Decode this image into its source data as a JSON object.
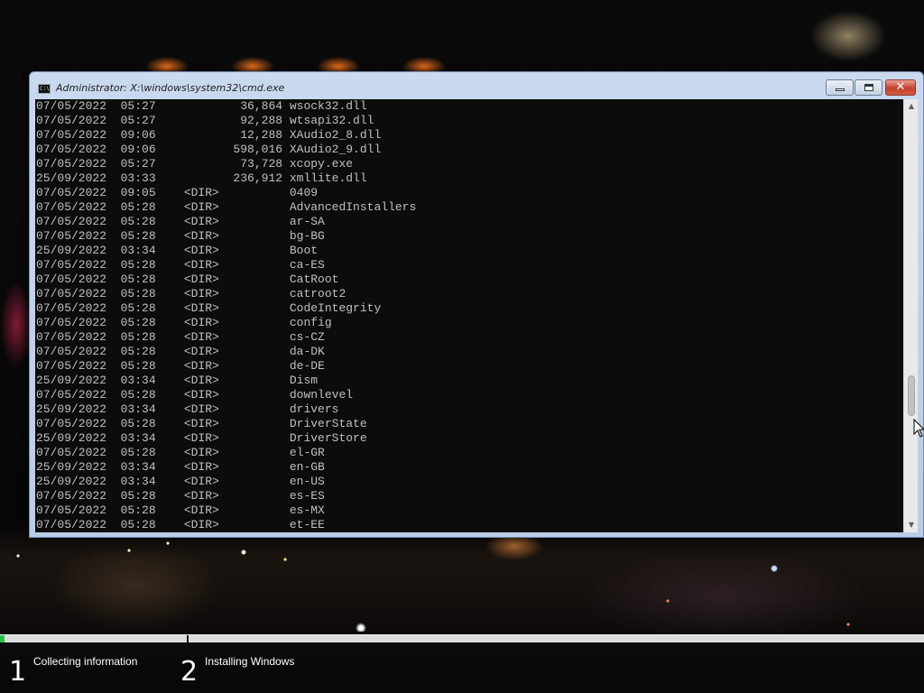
{
  "window": {
    "title": "Administrator: X:\\windows\\system32\\cmd.exe",
    "icon": "console-icon",
    "icon_text": "C:\\",
    "close_glyph": "✕"
  },
  "console": {
    "lines": [
      "07/05/2022  05:27            36,864 wsock32.dll",
      "07/05/2022  05:27            92,288 wtsapi32.dll",
      "07/05/2022  09:06            12,288 XAudio2_8.dll",
      "07/05/2022  09:06           598,016 XAudio2_9.dll",
      "07/05/2022  05:27            73,728 xcopy.exe",
      "25/09/2022  03:33           236,912 xmllite.dll",
      "07/05/2022  09:05    <DIR>          0409",
      "07/05/2022  05:28    <DIR>          AdvancedInstallers",
      "07/05/2022  05:28    <DIR>          ar-SA",
      "07/05/2022  05:28    <DIR>          bg-BG",
      "25/09/2022  03:34    <DIR>          Boot",
      "07/05/2022  05:28    <DIR>          ca-ES",
      "07/05/2022  05:28    <DIR>          CatRoot",
      "07/05/2022  05:28    <DIR>          catroot2",
      "07/05/2022  05:28    <DIR>          CodeIntegrity",
      "07/05/2022  05:28    <DIR>          config",
      "07/05/2022  05:28    <DIR>          cs-CZ",
      "07/05/2022  05:28    <DIR>          da-DK",
      "07/05/2022  05:28    <DIR>          de-DE",
      "25/09/2022  03:34    <DIR>          Dism",
      "07/05/2022  05:28    <DIR>          downlevel",
      "25/09/2022  03:34    <DIR>          drivers",
      "07/05/2022  05:28    <DIR>          DriverState",
      "25/09/2022  03:34    <DIR>          DriverStore",
      "07/05/2022  05:28    <DIR>          el-GR",
      "25/09/2022  03:34    <DIR>          en-GB",
      "25/09/2022  03:34    <DIR>          en-US",
      "07/05/2022  05:28    <DIR>          es-ES",
      "07/05/2022  05:28    <DIR>          es-MX",
      "07/05/2022  05:28    <DIR>          et-EE"
    ],
    "scroll_fraction": 0.72
  },
  "setup": {
    "progress_fraction": 0.005,
    "progress_color": "#29c24a",
    "steps": [
      {
        "number": "1",
        "label": "Collecting information"
      },
      {
        "number": "2",
        "label": "Installing Windows"
      }
    ]
  }
}
